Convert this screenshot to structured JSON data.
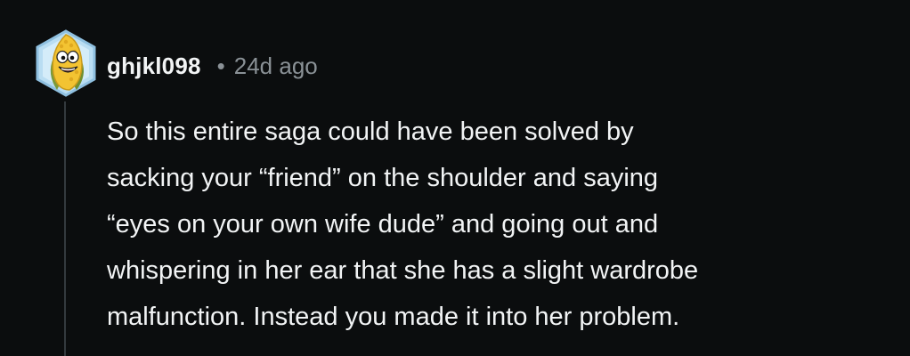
{
  "comment": {
    "username": "ghjkl098",
    "separator": "•",
    "time_ago": "24d ago",
    "body_lines": [
      "So this entire saga could have been solved by",
      "sacking your “friend” on the shoulder and saying",
      "“eyes on your own wife dude” and going out and",
      "whispering in her ear that she has a slight wardrobe",
      "malfunction. Instead you made it into her problem."
    ]
  },
  "colors": {
    "background": "#0b0d0e",
    "text": "#f2f4f5",
    "muted": "#8a9196",
    "avatar_frame": "#9bc7e6",
    "avatar_character": "#f3c332"
  },
  "icons": {
    "avatar": "corn-cob-character-avatar"
  }
}
